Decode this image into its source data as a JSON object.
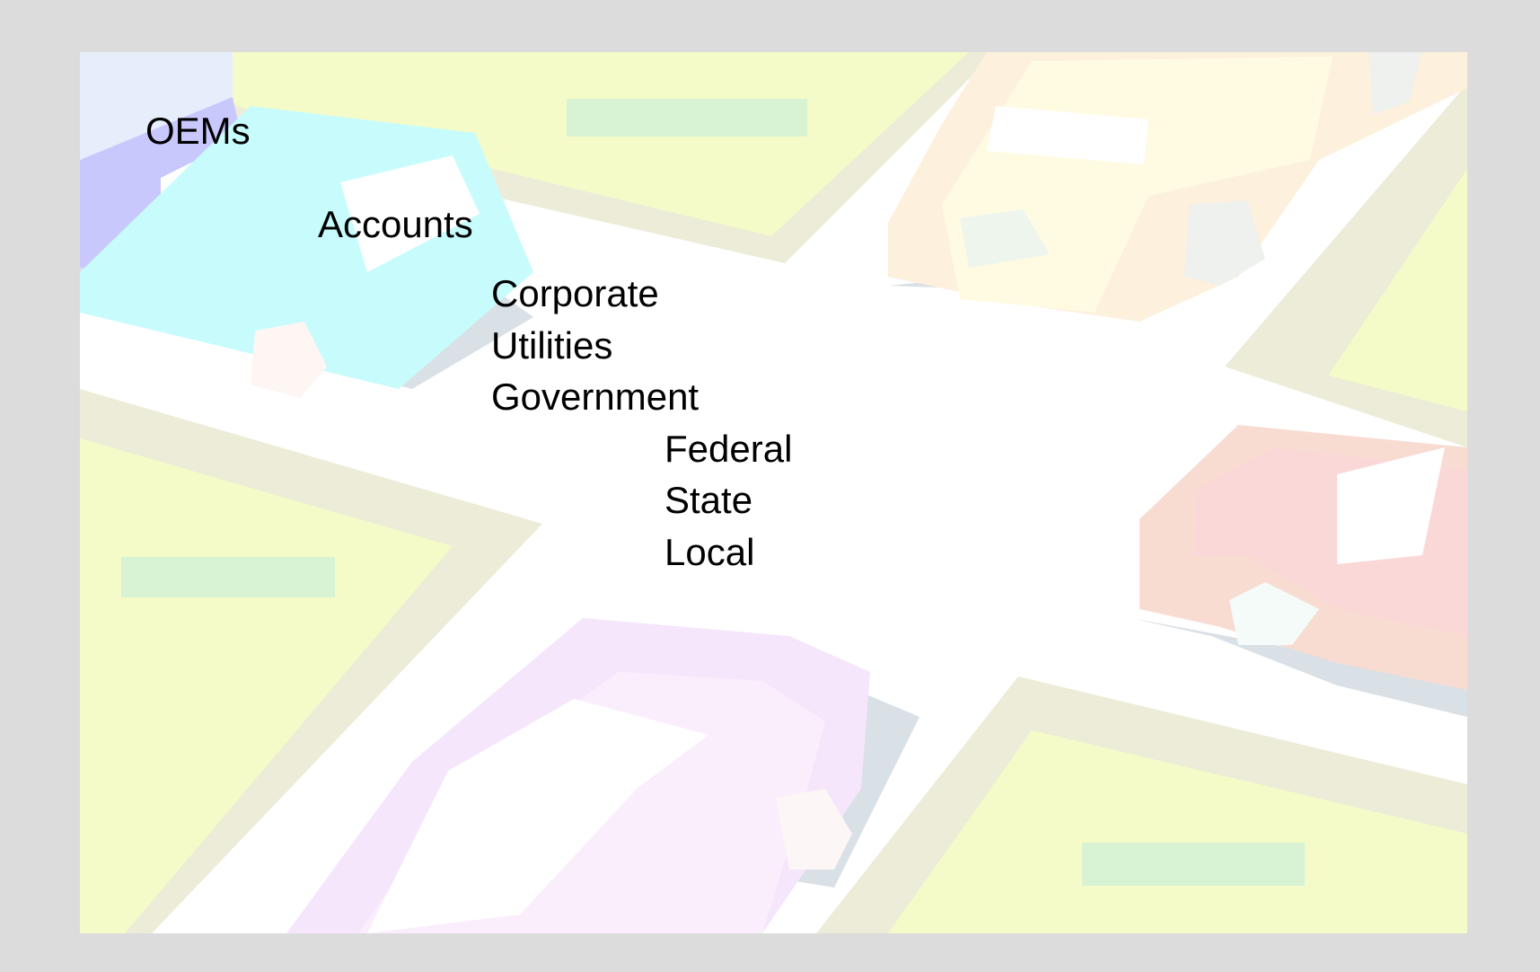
{
  "outline": {
    "level1": [
      "OEMs"
    ],
    "level2": [
      "Accounts"
    ],
    "level3": [
      "Corporate",
      "Utilities",
      "Government"
    ],
    "level4": [
      "Federal",
      "State",
      "Local"
    ]
  },
  "background": {
    "style": "faded street-map clip art with cars at an intersection",
    "colors": {
      "frame": "#dcdcdc",
      "road": "#ffffff",
      "grass": "#f4fbc8",
      "curb": "#ececd8",
      "patch": "#d8f2d4",
      "car_cyan": "#c8fcfc",
      "car_violet": "#c8c8fc",
      "car_yellow": "#fffbe3",
      "car_pink": "#fbd8d8",
      "car_purple": "#f5e6fb",
      "shadow": "#d9e0e6"
    }
  }
}
